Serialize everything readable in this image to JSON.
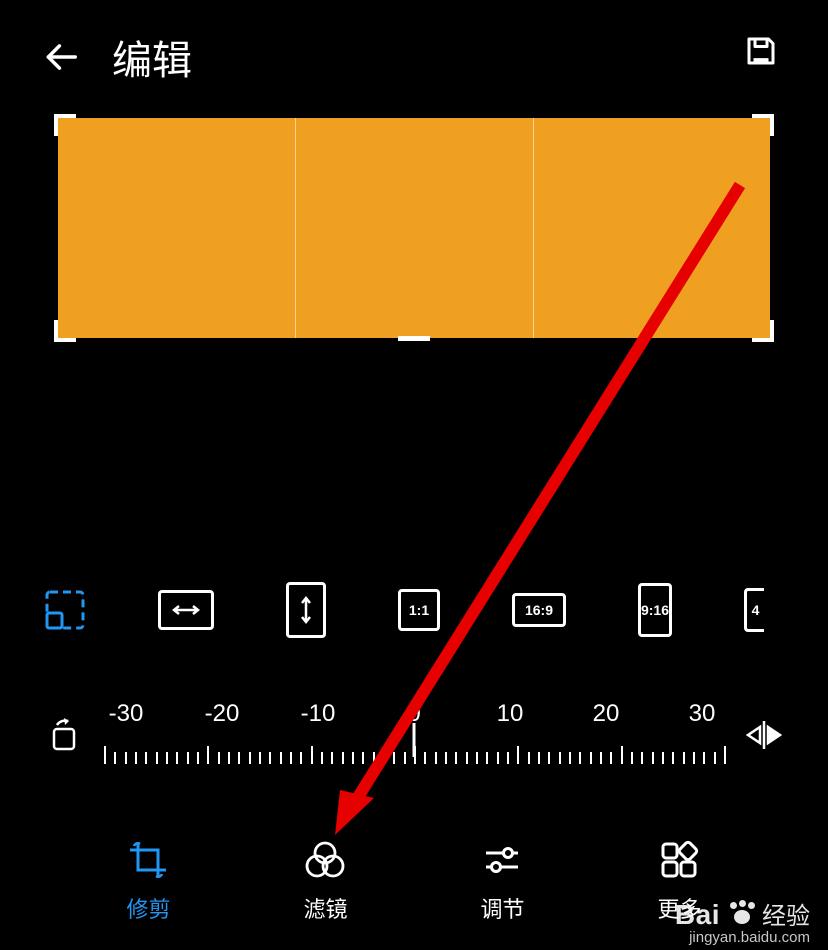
{
  "header": {
    "title": "编辑"
  },
  "colors": {
    "image_fill": "#f0a020",
    "active": "#2196f3"
  },
  "aspect_options": [
    {
      "id": "free",
      "label": "",
      "w": 42,
      "h": 42,
      "type": "free"
    },
    {
      "id": "horizontal",
      "label": "↔",
      "w": 56,
      "h": 40,
      "type": "arrow-h"
    },
    {
      "id": "vertical",
      "label": "↕",
      "w": 40,
      "h": 56,
      "type": "arrow-v"
    },
    {
      "id": "1-1",
      "label": "1:1",
      "w": 42,
      "h": 42,
      "type": "text"
    },
    {
      "id": "16-9",
      "label": "16:9",
      "w": 54,
      "h": 34,
      "type": "text"
    },
    {
      "id": "9-16",
      "label": "9:16",
      "w": 34,
      "h": 54,
      "type": "text"
    },
    {
      "id": "4-3",
      "label": "4",
      "w": 34,
      "h": 44,
      "type": "text-partial"
    }
  ],
  "ruler": {
    "labels": [
      "-30",
      "-20",
      "-10",
      "0",
      "10",
      "20",
      "30"
    ],
    "min": -30,
    "max": 30,
    "value": 0
  },
  "nav": {
    "items": [
      {
        "id": "crop",
        "label": "修剪",
        "active": true
      },
      {
        "id": "filter",
        "label": "滤镜",
        "active": false
      },
      {
        "id": "adjust",
        "label": "调节",
        "active": false
      },
      {
        "id": "more",
        "label": "更多",
        "active": false
      }
    ]
  },
  "watermark": {
    "brand": "Bai",
    "brand2": "经验",
    "url": "jingyan.baidu.com"
  },
  "annotation": {
    "arrow_target": "filter"
  }
}
